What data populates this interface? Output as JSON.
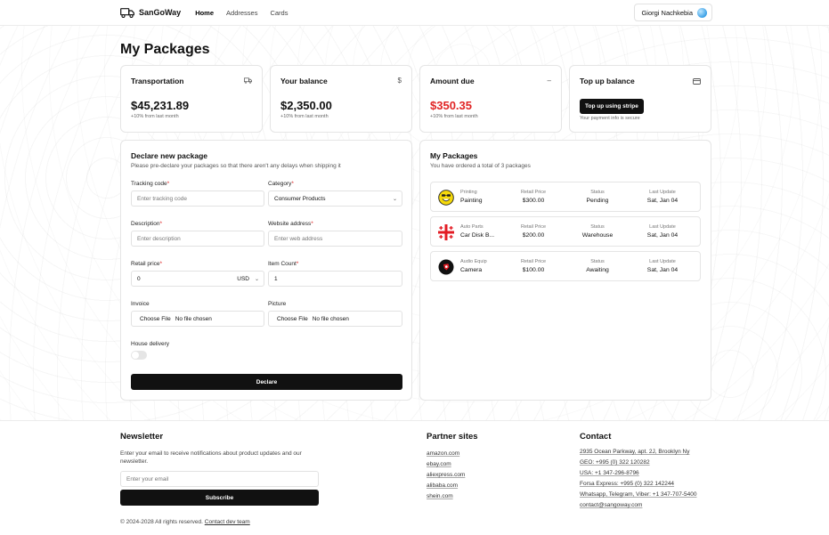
{
  "app": {
    "name": "SanGoWay"
  },
  "nav": {
    "items": [
      "Home",
      "Addresses",
      "Cards"
    ],
    "active": "Home"
  },
  "user": {
    "name": "Giorgi Nachkebia"
  },
  "page": {
    "title": "My Packages"
  },
  "stats": {
    "transportation": {
      "title": "Transportation",
      "value": "$45,231.89",
      "sub": "+10% from last month",
      "icon": "truck-icon"
    },
    "balance": {
      "title": "Your balance",
      "value": "$2,350.00",
      "sub": "+10% from last month",
      "icon": "dollar-icon"
    },
    "due": {
      "title": "Amount due",
      "value": "$350.35",
      "sub": "+10% from last month",
      "icon": "minus-icon",
      "color": "#e02424"
    },
    "topup": {
      "title": "Top up balance",
      "button": "Top up using stripe",
      "sub": "Your payment info is secure",
      "icon": "credit-card-icon"
    }
  },
  "declare": {
    "title": "Declare new package",
    "subtitle": "Please pre-declare your packages so that there aren't any delays when shipping it",
    "tracking": {
      "label": "Tracking code",
      "placeholder": "Enter tracking code"
    },
    "category": {
      "label": "Category",
      "value": "Consumer Products"
    },
    "description": {
      "label": "Description",
      "placeholder": "Enter description"
    },
    "website": {
      "label": "Website address",
      "placeholder": "Enter web address"
    },
    "price": {
      "label": "Retail price",
      "value": "0",
      "currency": "USD"
    },
    "count": {
      "label": "Item Count",
      "value": "1"
    },
    "invoice": {
      "label": "Invoice",
      "button": "Choose File",
      "status": "No file chosen"
    },
    "picture": {
      "label": "Picture",
      "button": "Choose File",
      "status": "No file chosen"
    },
    "delivery": {
      "label": "House delivery",
      "on": false
    },
    "submit": "Declare",
    "required_mark": "*"
  },
  "packages": {
    "title": "My Packages",
    "subtitle": "You have ordered a total of 3 packages",
    "labels": {
      "price": "Retail Price",
      "status": "Status",
      "update": "Last Update"
    },
    "rows": [
      {
        "category": "Printing",
        "name": "Painting",
        "price": "$300.00",
        "status": "Pending",
        "update": "Sat, Jan 04",
        "icon": "smiley-icon"
      },
      {
        "category": "Auto Parts",
        "name": "Car Disk B...",
        "price": "$200.00",
        "status": "Warehouse",
        "update": "Sat, Jan 04",
        "icon": "georgia-flag-icon"
      },
      {
        "category": "Audio Equip",
        "name": "Camera",
        "price": "$100.00",
        "status": "Awaiting",
        "update": "Sat, Jan 04",
        "icon": "camera-logo-icon"
      }
    ]
  },
  "footer": {
    "newsletter": {
      "title": "Newsletter",
      "text": "Enter your email to receive notifications about product updates and our newsletter.",
      "placeholder": "Enter your email",
      "button": "Subscribe"
    },
    "partners": {
      "title": "Partner sites",
      "links": [
        "amazon.com",
        "ebay.com",
        "aliexpress.com",
        "alibaba.com",
        "shein.com"
      ]
    },
    "contact": {
      "title": "Contact",
      "lines": [
        "2935 Ocean Parkway, apt. 2J, Brooklyn Ny",
        "GEO: +995 (0) 322 120282",
        "USA: +1 347-296-8796",
        "Forsa Express: +995 (0) 322 142244",
        "Whatsapp, Telegram, Viber: +1 347-707-5400",
        "contact@sangoway.com"
      ]
    },
    "copyright": "© 2024-2028 All rights reserved.",
    "contact_dev": "Contact dev team"
  }
}
